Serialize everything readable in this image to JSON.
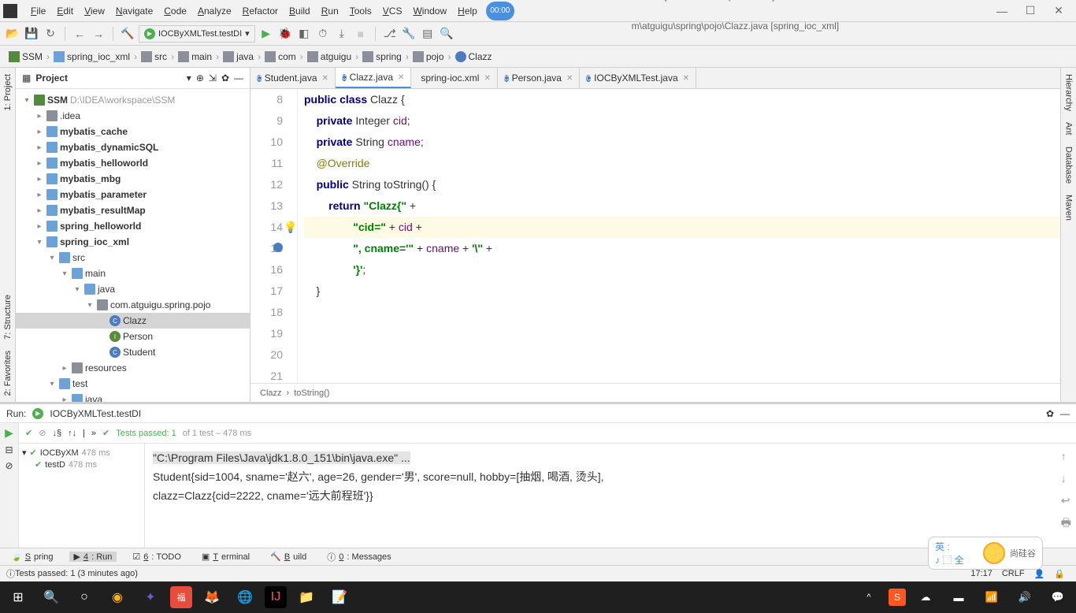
{
  "titlebar": {
    "app_title": "SSM [D:\\IDEA\\workspace\\SSM] - ...\\src\\main",
    "app_title_suffix": "m\\atguigu\\spring\\pojo\\Clazz.java [spring_ioc_xml]",
    "timer": "00:00",
    "menus": [
      "File",
      "Edit",
      "View",
      "Navigate",
      "Code",
      "Analyze",
      "Refactor",
      "Build",
      "Run",
      "Tools",
      "VCS",
      "Window",
      "Help"
    ]
  },
  "toolbar": {
    "run_config": "IOCByXMLTest.testDI"
  },
  "breadcrumb": [
    "SSM",
    "spring_ioc_xml",
    "src",
    "main",
    "java",
    "com",
    "atguigu",
    "spring",
    "pojo",
    "Clazz"
  ],
  "project": {
    "title": "Project",
    "root": "SSM",
    "root_path": "D:\\IDEA\\workspace\\SSM",
    "nodes": [
      ".idea",
      "mybatis_cache",
      "mybatis_dynamicSQL",
      "mybatis_helloworld",
      "mybatis_mbg",
      "mybatis_parameter",
      "mybatis_resultMap",
      "spring_helloworld",
      "spring_ioc_xml"
    ],
    "sub": [
      "src",
      "main",
      "java",
      "com.atguigu.spring.pojo"
    ],
    "classes": [
      "Clazz",
      "Person",
      "Student"
    ],
    "tail": [
      "resources",
      "test",
      "java"
    ]
  },
  "editor": {
    "tabs": [
      {
        "name": "Student.java",
        "icon": "class"
      },
      {
        "name": "Clazz.java",
        "icon": "class",
        "active": true
      },
      {
        "name": "spring-ioc.xml",
        "icon": "xml"
      },
      {
        "name": "Person.java",
        "icon": "class"
      },
      {
        "name": "IOCByXMLTest.java",
        "icon": "class"
      }
    ],
    "lines": [
      {
        "n": 8,
        "html": "<span class='kw'>public class</span> Clazz {"
      },
      {
        "n": 9,
        "html": ""
      },
      {
        "n": 10,
        "html": "    <span class='kw'>private</span> Integer <span class='fld'>cid</span>;"
      },
      {
        "n": 11,
        "html": ""
      },
      {
        "n": 12,
        "html": "    <span class='kw'>private</span> String <span class='fld'>cname</span>;"
      },
      {
        "n": 13,
        "html": ""
      },
      {
        "n": 14,
        "html": "    <span class='ann'>@Override</span>"
      },
      {
        "n": 15,
        "html": "    <span class='kw'>public</span> String toString() {",
        "override": true
      },
      {
        "n": 16,
        "html": "        <span class='kw'>return</span> <span class='str'>\"Clazz{\"</span> +"
      },
      {
        "n": 17,
        "html": "                <span class='str'>\"cid=\"</span> + <span class='fld'>cid</span> +",
        "hl": true,
        "bulb": true
      },
      {
        "n": 18,
        "html": "                <span class='str'>\", cname='\"</span> + <span class='fld'>cname</span> + <span class='str'>'\\''</span> +"
      },
      {
        "n": 19,
        "html": "                <span class='str'>'}'</span>;"
      },
      {
        "n": 20,
        "html": "    }"
      },
      {
        "n": 21,
        "html": ""
      }
    ],
    "crumb": [
      "Clazz",
      "toString()"
    ]
  },
  "run": {
    "title": "Run:",
    "config": "IOCByXMLTest.testDI",
    "tests_passed": "Tests passed: 1",
    "tests_total": " of 1 test – 478 ms",
    "tree": [
      {
        "name": "IOCByXM",
        "time": "478 ms"
      },
      {
        "name": "testD",
        "time": "478 ms"
      }
    ],
    "console": [
      {
        "text": "\"C:\\Program Files\\Java\\jdk1.8.0_151\\bin\\java.exe\" ...",
        "cmd": true
      },
      {
        "text": "Student{sid=1004, sname='赵六', age=26, gender='男', score=null, hobby=[抽烟, 喝酒, 烫头], "
      },
      {
        "text": "clazz=Clazz{cid=2222, cname='远大前程班'}}"
      }
    ]
  },
  "bottom_tabs": [
    "Spring",
    "4: Run",
    "6: TODO",
    "Terminal",
    "Build",
    "0: Messages"
  ],
  "status": {
    "msg": "Tests passed: 1 (3 minutes ago)",
    "time": "17:17",
    "encoding": "CRLF"
  },
  "side_tabs_left": [
    "1: Project",
    "7: Structure",
    "2: Favorites"
  ],
  "side_tabs_right": [
    "Hierarchy",
    "Ant",
    "Database",
    "Maven"
  ],
  "ime": {
    "lang": "英 :",
    "name": "尚硅谷"
  }
}
